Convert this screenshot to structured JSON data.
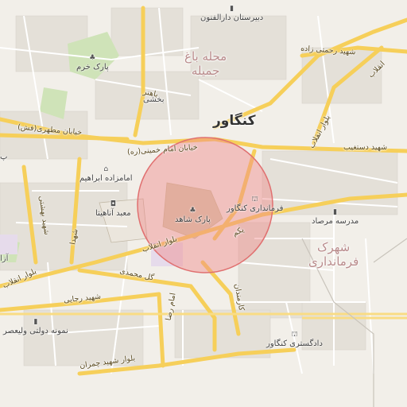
{
  "map": {
    "city_name": "کنگاور",
    "districts": [
      {
        "id": "bagh-jamileh",
        "line1": "محله باغ",
        "line2": "جمیله"
      },
      {
        "id": "farmandari",
        "line1": "شهرک",
        "line2": "فرمانداری"
      }
    ],
    "streets": {
      "khayaban_motahari": "خیابان مطهری(فش)",
      "khayaban_imam": "خیابان امام خمینی(ره)",
      "bahonar": "باهنر",
      "enghelab_ne": "بلوار انقلاب",
      "shahid_rahmati": "شهید رحمتی زاده",
      "enghelab_top": "انقلاب",
      "shahid_dastgheib": "شهید دستغیب",
      "shahid_bahonar_w": "شهید بهشتی",
      "enghelab_main": "بلوار انقلاب",
      "enghelab_west": "بلوار انقلاب",
      "gol_mohammadi": "گل محمدی",
      "shahid_rajabi": "شهید رجایی",
      "imam_reza": "امام رضا",
      "karmandan": "کارمندان",
      "shahid_chamran": "بلوار شهید چمران",
      "yekom": "یکم",
      "shahid_beheshti_n": "شهدا"
    },
    "pois": [
      {
        "id": "park-khorram",
        "icon": "tree-icon",
        "label": "پارک خرم"
      },
      {
        "id": "dabirestan",
        "icon": "school-icon",
        "label": "دبیرستان دارالفنون"
      },
      {
        "id": "emamzadeh",
        "icon": "shrine-icon",
        "label": "امامزاده ابراهیم"
      },
      {
        "id": "anahita",
        "icon": "museum-icon",
        "label": "معبد آناهیتا"
      },
      {
        "id": "park-shahed",
        "icon": "tree-icon",
        "label": "پارک شاهد"
      },
      {
        "id": "farmandari-bldg",
        "icon": "government-icon",
        "label": "فرمانداری کنگاور"
      },
      {
        "id": "madreseh-morsad",
        "icon": "school-icon",
        "label": "مدرسه مرصاد"
      },
      {
        "id": "nemooneh",
        "icon": "school-icon",
        "label": "نمونه دولتی ولیعصر"
      },
      {
        "id": "dadgostari",
        "icon": "government-icon",
        "label": "دادگستری کنگاور"
      }
    ],
    "edge_fragments": [
      "آزا",
      "پ",
      "بخشی"
    ],
    "highlight": {
      "description_color": "#f08a8a"
    }
  }
}
